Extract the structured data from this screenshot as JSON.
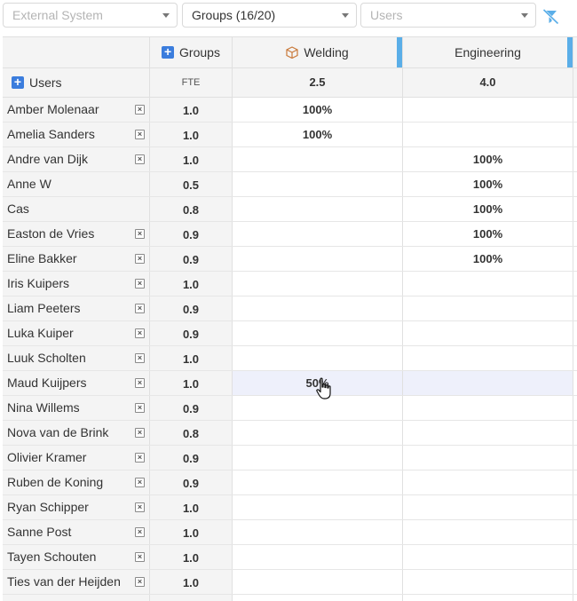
{
  "toolbar": {
    "external_system": {
      "placeholder": "External System"
    },
    "groups": {
      "value": "Groups (16/20)"
    },
    "users": {
      "placeholder": "Users"
    }
  },
  "header": {
    "groups_label": "Groups",
    "users_label": "Users",
    "fte_label": "FTE",
    "columns": [
      {
        "label": "Welding",
        "total": "2.5",
        "icon": "box-icon"
      },
      {
        "label": "Engineering",
        "total": "4.0",
        "icon": ""
      }
    ]
  },
  "rows": [
    {
      "name": "Amber Molenaar",
      "fte": "1.0",
      "welding": "100%",
      "engineering": "",
      "removable": true
    },
    {
      "name": "Amelia Sanders",
      "fte": "1.0",
      "welding": "100%",
      "engineering": "",
      "removable": true
    },
    {
      "name": "Andre van Dijk",
      "fte": "1.0",
      "welding": "",
      "engineering": "100%",
      "removable": true
    },
    {
      "name": "Anne W",
      "fte": "0.5",
      "welding": "",
      "engineering": "100%",
      "removable": false
    },
    {
      "name": "Cas",
      "fte": "0.8",
      "welding": "",
      "engineering": "100%",
      "removable": false
    },
    {
      "name": "Easton de Vries",
      "fte": "0.9",
      "welding": "",
      "engineering": "100%",
      "removable": true
    },
    {
      "name": "Eline Bakker",
      "fte": "0.9",
      "welding": "",
      "engineering": "100%",
      "removable": true
    },
    {
      "name": "Iris Kuipers",
      "fte": "1.0",
      "welding": "",
      "engineering": "",
      "removable": true
    },
    {
      "name": "Liam Peeters",
      "fte": "0.9",
      "welding": "",
      "engineering": "",
      "removable": true
    },
    {
      "name": "Luka Kuiper",
      "fte": "0.9",
      "welding": "",
      "engineering": "",
      "removable": true
    },
    {
      "name": "Luuk Scholten",
      "fte": "1.0",
      "welding": "",
      "engineering": "",
      "removable": true
    },
    {
      "name": "Maud Kuijpers",
      "fte": "1.0",
      "welding": "50%",
      "engineering": "",
      "removable": true,
      "highlighted": true
    },
    {
      "name": "Nina Willems",
      "fte": "0.9",
      "welding": "",
      "engineering": "",
      "removable": true
    },
    {
      "name": "Nova van de Brink",
      "fte": "0.8",
      "welding": "",
      "engineering": "",
      "removable": true
    },
    {
      "name": "Olivier Kramer",
      "fte": "0.9",
      "welding": "",
      "engineering": "",
      "removable": true
    },
    {
      "name": "Ruben de Koning",
      "fte": "0.9",
      "welding": "",
      "engineering": "",
      "removable": true
    },
    {
      "name": "Ryan Schipper",
      "fte": "1.0",
      "welding": "",
      "engineering": "",
      "removable": true
    },
    {
      "name": "Sanne Post",
      "fte": "1.0",
      "welding": "",
      "engineering": "",
      "removable": true
    },
    {
      "name": "Tayen Schouten",
      "fte": "1.0",
      "welding": "",
      "engineering": "",
      "removable": true
    },
    {
      "name": "Ties van der Heijden",
      "fte": "1.0",
      "welding": "",
      "engineering": "",
      "removable": true
    },
    {
      "name": "",
      "fte": "",
      "welding": "",
      "engineering": "",
      "removable": false
    }
  ],
  "colors": {
    "accent": "#3b7ddd",
    "column_bar": "#5aaee8",
    "highlight_row": "#eef0fb",
    "box_icon": "#c9793a"
  }
}
